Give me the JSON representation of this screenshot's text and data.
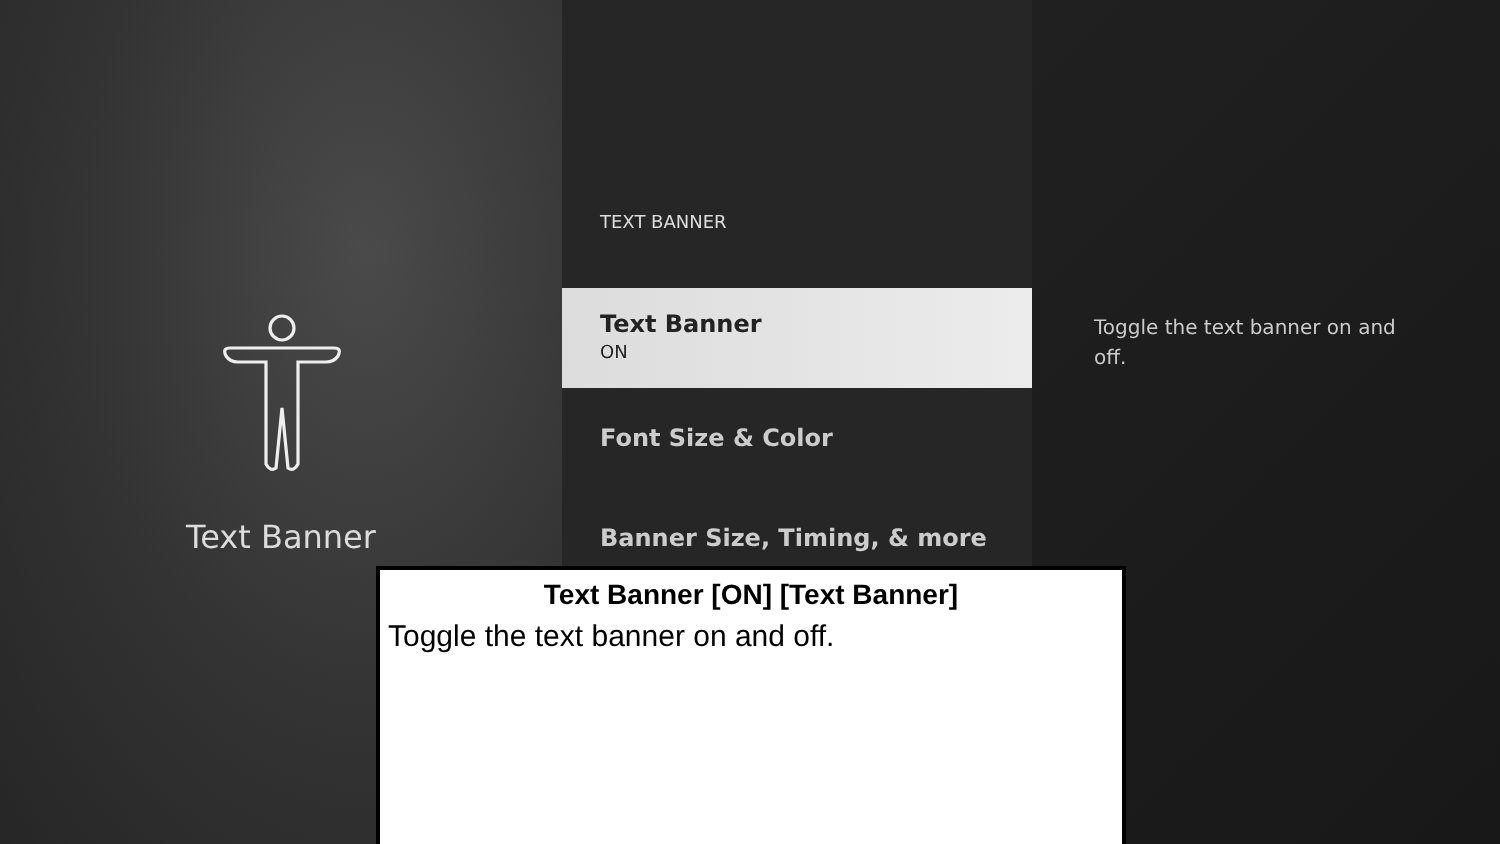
{
  "left_panel": {
    "title": "Text Banner"
  },
  "menu": {
    "heading": "TEXT BANNER",
    "items": [
      {
        "label": "Text Banner",
        "value": "ON",
        "selected": true
      },
      {
        "label": "Font Size & Color",
        "selected": false
      },
      {
        "label": "Banner Size, Timing, & more",
        "selected": false
      }
    ]
  },
  "description": "Toggle the text banner on and off.",
  "text_banner_overlay": {
    "title": "Text Banner [ON] [Text Banner]",
    "body": "Toggle the text banner on and off."
  }
}
